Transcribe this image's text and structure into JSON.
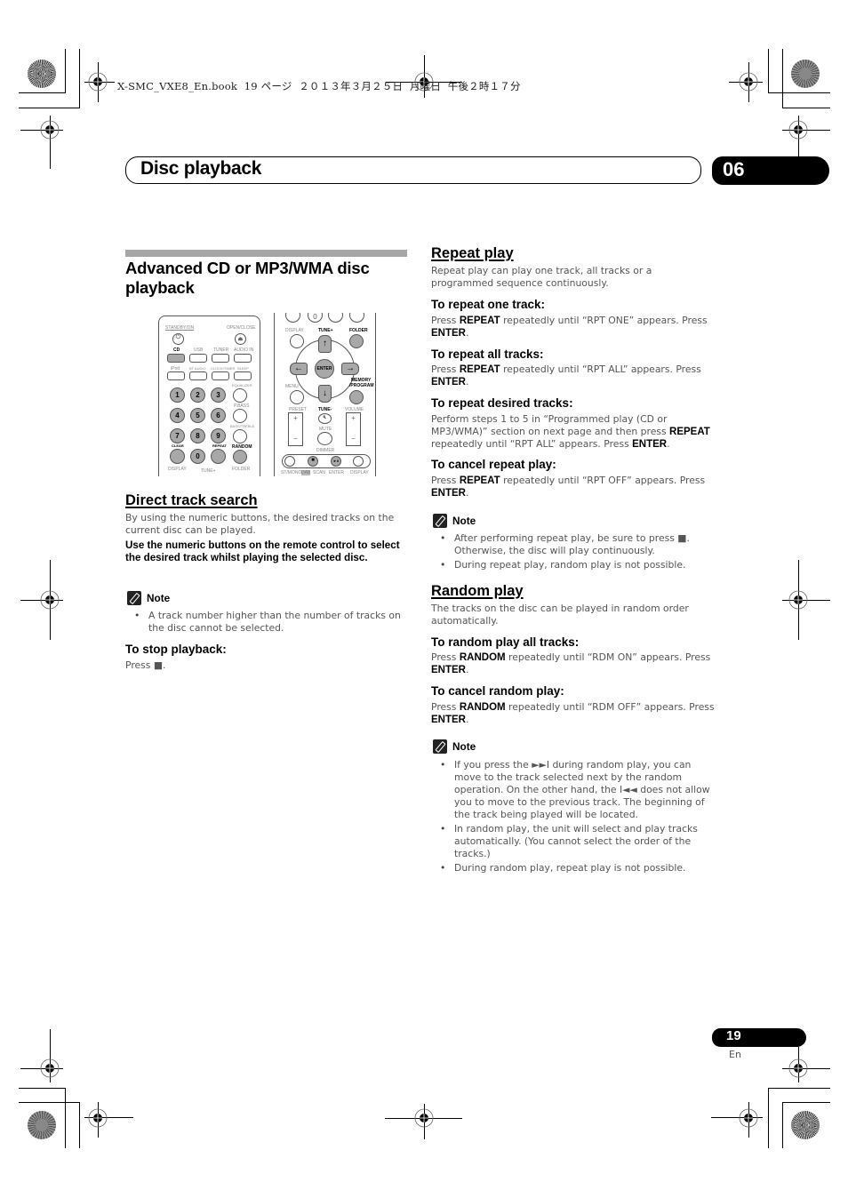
{
  "print_header": "X-SMC_VXE8_En.book  19 ページ  ２０１３年３月２５日  月曜日  午後２時１７分",
  "chapter": {
    "title": "Disc playback",
    "number": "06"
  },
  "left": {
    "section_title": "Advanced CD or MP3/WMA disc playback",
    "remote_left": {
      "labels": {
        "standby": "STANDBY/ON",
        "open_close": "OPEN/CLOSE",
        "cd": "CD",
        "usb": "USB",
        "tuner": "TUNER",
        "audio_in": "AUDIO IN",
        "ipod": "iPod",
        "bt_audio": "BT AUDIO",
        "clock_timer": "CLOCK/TIMER",
        "sleep": "SLEEP",
        "equalizer": "EQUALIZER",
        "pbass": "P.BASS",
        "bass_treble": "BASS/TREBLE",
        "clear": "CLEAR",
        "repeat": "REPEAT",
        "random": "RANDOM",
        "display": "DISPLAY",
        "tune_plus": "TUNE+",
        "folder": "FOLDER"
      },
      "numbers": [
        "1",
        "2",
        "3",
        "4",
        "5",
        "6",
        "7",
        "8",
        "9",
        "0"
      ]
    },
    "remote_right": {
      "labels": {
        "zero": "0",
        "display": "DISPLAY",
        "tune_plus": "TUNE+",
        "folder": "FOLDER",
        "enter": "ENTER",
        "menu": "MENU",
        "memory": "MEMORY",
        "program": "/PROGRAM",
        "preset": "PRESET",
        "tune_minus": "TUNE-",
        "volume": "VOLUME",
        "mute": "MUTE",
        "dimmer": "DIMMER",
        "plus": "+",
        "minus": "−",
        "st_mono": "ST/MONO",
        "dab": "DAB",
        "scan": "SCAN",
        "enter2": "ENTER",
        "display2": "DISPLAY"
      }
    },
    "direct_track": {
      "heading": "Direct track search",
      "intro": "By using the numeric buttons, the desired tracks on the current disc can be played.",
      "instruction": "Use the numeric buttons on the remote control to select the desired track whilst playing the selected disc.",
      "note_label": "Note",
      "notes": [
        "A track number higher than the number of tracks on the disc cannot be selected."
      ],
      "stop_heading": "To stop playback:",
      "stop_text": "Press ■."
    }
  },
  "right": {
    "repeat": {
      "heading": "Repeat play",
      "intro": "Repeat play can play one track, all tracks or a programmed sequence continuously.",
      "one": {
        "heading": "To repeat one track:",
        "pre": "Press ",
        "key": "REPEAT",
        "mid": " repeatedly until “RPT ONE” appears. Press ",
        "key2": "ENTER",
        "end": "."
      },
      "all": {
        "heading": "To repeat all tracks:",
        "pre": "Press ",
        "key": "REPEAT",
        "mid": " repeatedly until “RPT ALL” appears. Press ",
        "key2": "ENTER",
        "end": "."
      },
      "desired": {
        "heading": "To repeat desired tracks:",
        "pre": "Perform steps 1 to 5 in “Programmed play (CD or MP3/WMA)” section on next page and then press ",
        "key": "REPEAT",
        "mid": " repeatedly until “RPT ALL” appears. Press ",
        "key2": "ENTER",
        "end": "."
      },
      "cancel": {
        "heading": "To cancel repeat play:",
        "pre": "Press ",
        "key": "REPEAT",
        "mid": " repeatedly until “RPT OFF” appears. Press ",
        "key2": "ENTER",
        "end": "."
      },
      "note_label": "Note",
      "notes": [
        "After performing repeat play, be sure to press ■. Otherwise, the disc will play continuously.",
        "During repeat play, random play is not possible."
      ]
    },
    "random": {
      "heading": "Random play",
      "intro": "The tracks on the disc can be played in random order automatically.",
      "all": {
        "heading": "To random play all tracks:",
        "pre": "Press ",
        "key": "RANDOM",
        "mid": " repeatedly until “RDM ON” appears. Press ",
        "key2": "ENTER",
        "end": "."
      },
      "cancel": {
        "heading": "To cancel random play:",
        "pre": "Press ",
        "key": "RANDOM",
        "mid": " repeatedly until “RDM OFF” appears. Press ",
        "key2": "ENTER",
        "end": "."
      },
      "note_label": "Note",
      "notes": [
        "If you press the ►►I during random play, you can move to the track selected next by the random operation. On the other hand, the I◄◄ does not allow you to move to the previous track. The beginning of the track being played will be located.",
        "In random play, the unit will select and play tracks automatically. (You cannot select the order of the tracks.)",
        "During random play, repeat play is not possible."
      ]
    }
  },
  "footer": {
    "page_number": "19",
    "language": "En"
  }
}
